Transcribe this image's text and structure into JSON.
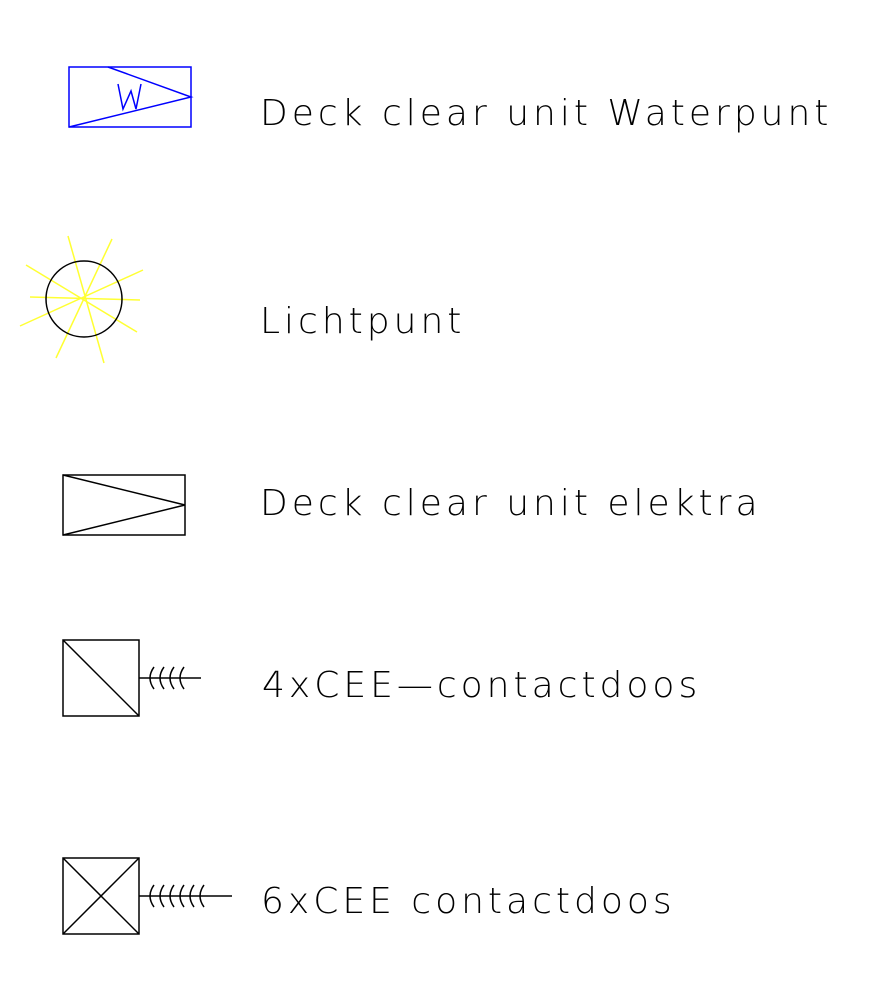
{
  "legend": {
    "items": [
      {
        "label": "Deck clear unit Waterpunt",
        "icon": "water-point-symbol-icon",
        "color": "#0000ff",
        "glyph": "W"
      },
      {
        "label": "Lichtpunt",
        "icon": "light-point-symbol-icon",
        "color": "#000000",
        "ray_color": "#ffff33"
      },
      {
        "label": "Deck clear unit elektra",
        "icon": "electric-unit-symbol-icon",
        "color": "#000000"
      },
      {
        "label": "4xCEE—contactdoos",
        "icon": "socket-4x-symbol-icon",
        "color": "#000000",
        "socket_count": 4
      },
      {
        "label": "6xCEE contactdoos",
        "icon": "socket-6x-symbol-icon",
        "color": "#000000",
        "socket_count": 6
      }
    ]
  }
}
